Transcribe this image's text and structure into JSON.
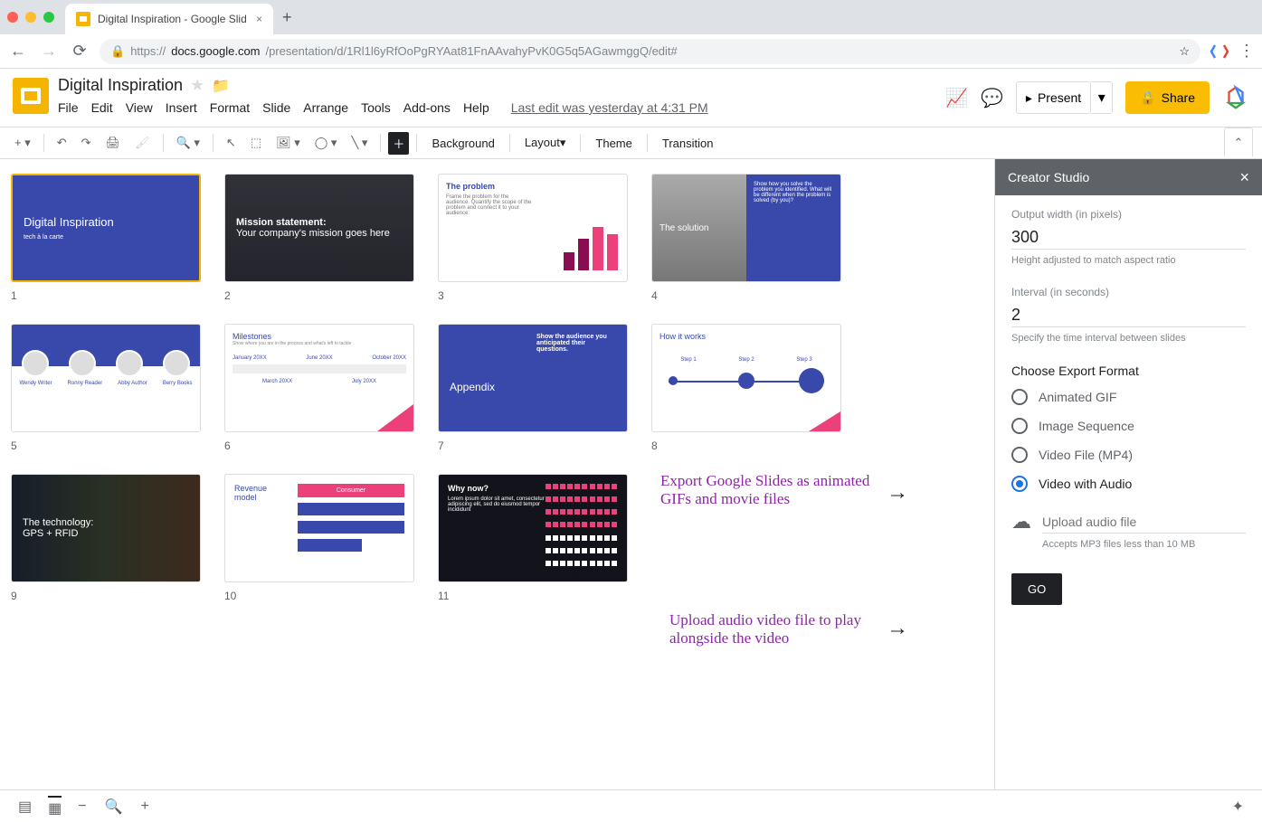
{
  "browser": {
    "tab_title": "Digital Inspiration - Google Slid",
    "url_prefix": "https://",
    "url_host": "docs.google.com",
    "url_path": "/presentation/d/1Rl1l6yRfOoPgRYAat81FnAAvahyPvK0G5q5AGawmggQ/edit#"
  },
  "doc": {
    "title": "Digital Inspiration",
    "last_edit": "Last edit was yesterday at 4:31 PM"
  },
  "menus": [
    "File",
    "Edit",
    "View",
    "Insert",
    "Format",
    "Slide",
    "Arrange",
    "Tools",
    "Add-ons",
    "Help"
  ],
  "toolbar": {
    "background": "Background",
    "layout": "Layout",
    "theme": "Theme",
    "transition": "Transition"
  },
  "header_buttons": {
    "present": "Present",
    "share": "Share"
  },
  "sidepanel": {
    "title": "Creator Studio",
    "width_label": "Output width (in pixels)",
    "width_value": "300",
    "width_hint": "Height adjusted to match aspect ratio",
    "interval_label": "Interval (in seconds)",
    "interval_value": "2",
    "interval_hint": "Specify the time interval between slides",
    "format_label": "Choose Export Format",
    "formats": [
      "Animated GIF",
      "Image Sequence",
      "Video File (MP4)",
      "Video with Audio"
    ],
    "upload_placeholder": "Upload audio file",
    "upload_hint": "Accepts MP3 files less than 10 MB",
    "go": "GO"
  },
  "annotations": {
    "a1": "Export Google Slides as animated GIFs and movie files",
    "a2": "Upload audio video file to play alongside the video"
  },
  "slides": [
    {
      "n": "1",
      "title": "Digital Inspiration",
      "sub": "tech à la carte"
    },
    {
      "n": "2",
      "title": "Mission statement:",
      "sub": "Your company's mission goes here"
    },
    {
      "n": "3",
      "title": "The problem",
      "sub": "Frame the problem for the audience. Quantify the scope of the problem and connect it to your audience."
    },
    {
      "n": "4",
      "title": "The solution",
      "sub": "Show how you solve the problem you identified. What will be different when the problem is solved (by you)?"
    },
    {
      "n": "5",
      "people": [
        "Wendy Writer",
        "Ronny Reader",
        "Abby Author",
        "Berry Books"
      ]
    },
    {
      "n": "6",
      "title": "Milestones",
      "sub": "Show where you are in the process and what's left to tackle",
      "cols": [
        "January 20XX",
        "June 20XX",
        "October 20XX"
      ],
      "row2": [
        "March 20XX",
        "July 20XX"
      ]
    },
    {
      "n": "7",
      "title": "Appendix",
      "sub": "Show the audience you anticipated their questions."
    },
    {
      "n": "8",
      "title": "How it works",
      "steps": [
        "Step 1",
        "Step 2",
        "Step 3"
      ]
    },
    {
      "n": "9",
      "title": "The technology:",
      "sub": "GPS + RFID"
    },
    {
      "n": "10",
      "title": "Revenue model",
      "badge": "Consumer"
    },
    {
      "n": "11",
      "title": "Why now?",
      "sub": "Lorem ipsum dolor sit amet, consectetur adipiscing elit, sed do eiusmod tempor incididunt"
    }
  ]
}
